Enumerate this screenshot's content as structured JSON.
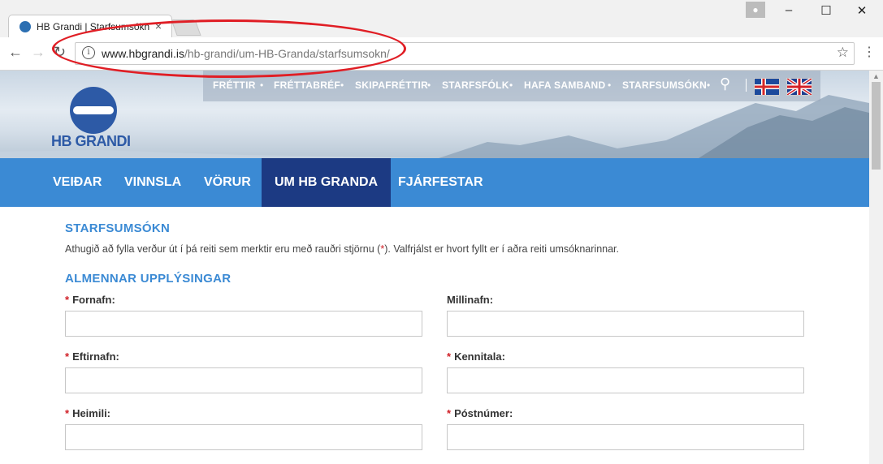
{
  "browser": {
    "tab_title": "HB Grandi | Starfsumsókn",
    "tab_close": "×",
    "url_host": "www.hbgrandi.is",
    "url_path": "/hb-grandi/um-HB-Granda/starfsumsokn/",
    "window_controls": [
      "–",
      "☐",
      "✕"
    ],
    "icons": [
      "back-arrow-icon",
      "forward-arrow-icon",
      "reload-icon",
      "info-icon",
      "star-icon",
      "menu-dots-icon"
    ]
  },
  "site": {
    "logo_text": "HB GRANDI",
    "brand_color": "#2d5aa6",
    "accent_color": "#3b8ad4",
    "top_nav": [
      "FRÉTTIR",
      "FRÉTTABRÉF",
      "SKIPAFRÉTTIR",
      "STARFSFÓLK",
      "HAFA SAMBAND",
      "STARFSUMSÓKN"
    ],
    "main_nav": [
      "VEIÐAR",
      "VINNSLA",
      "VÖRUR",
      "UM HB GRANDA",
      "FJÁRFESTAR"
    ],
    "main_nav_active": "UM HB GRANDA"
  },
  "form": {
    "title": "STARFSUMSÓKN",
    "intro_before": "Athugið að fylla verður út í þá reiti sem merktir eru með rauðri stjörnu (",
    "intro_star": "*",
    "intro_after": "). Valfrjálst er hvort fyllt er í aðra reiti umsóknarinnar.",
    "section_title": "ALMENNAR UPPLÝSINGAR",
    "required_mark": "*",
    "fields": [
      {
        "label": "Fornafn:",
        "required": true,
        "value": ""
      },
      {
        "label": "Millinafn:",
        "required": false,
        "value": ""
      },
      {
        "label": "Eftirnafn:",
        "required": true,
        "value": ""
      },
      {
        "label": "Kennitala:",
        "required": true,
        "value": ""
      },
      {
        "label": "Heimili:",
        "required": true,
        "value": ""
      },
      {
        "label": "Póstnúmer:",
        "required": true,
        "value": ""
      }
    ]
  }
}
